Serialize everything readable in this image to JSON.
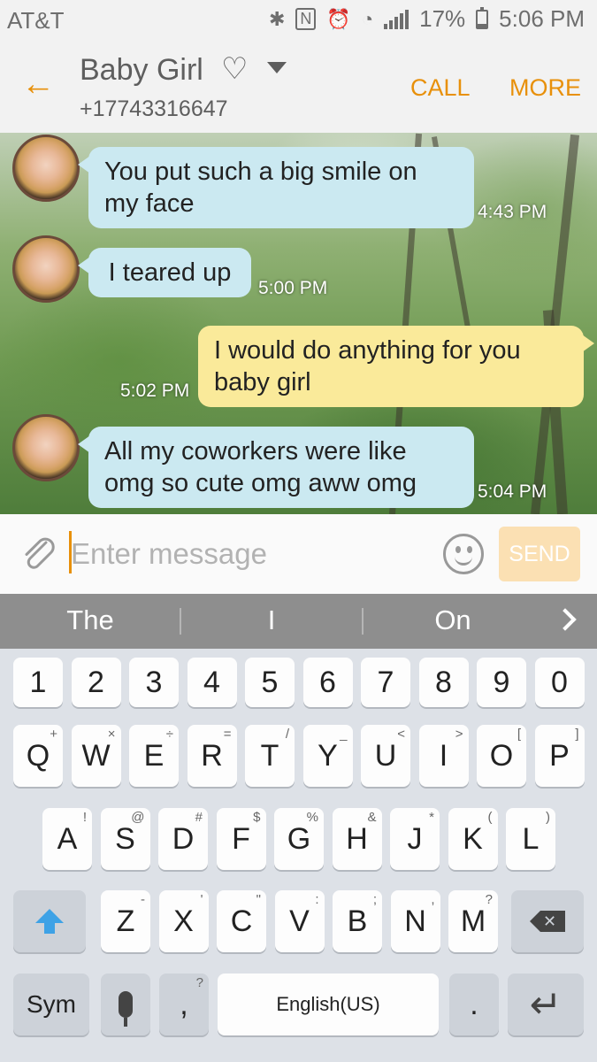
{
  "status_bar": {
    "carrier": "AT&T",
    "battery": "17%",
    "time": "5:06 PM",
    "icons": [
      "bluetooth-icon",
      "nfc-icon",
      "alarm-icon",
      "wifi-icon",
      "signal-icon",
      "battery-icon"
    ]
  },
  "header": {
    "back_icon": "arrow-left-icon",
    "contact_name": "Baby Girl",
    "heart": "♡",
    "contact_number": "+17743316647",
    "call_label": "CALL",
    "more_label": "MORE",
    "accent_color": "#e8900a"
  },
  "messages": [
    {
      "direction": "incoming",
      "text_lines": [
        "You put such a big smile on",
        "my face"
      ],
      "time": "4:43 PM"
    },
    {
      "direction": "incoming",
      "text_lines": [
        "I teared up"
      ],
      "time": "5:00 PM"
    },
    {
      "direction": "outgoing",
      "text_lines": [
        "I would do anything for you",
        "baby girl"
      ],
      "time": "5:02 PM"
    },
    {
      "direction": "incoming",
      "text_lines": [
        "All my coworkers were like",
        "omg so cute omg aww omg"
      ],
      "time": "5:04 PM"
    }
  ],
  "composer": {
    "placeholder": "Enter message",
    "send_label": "SEND"
  },
  "suggestions": [
    "The",
    "I",
    "On"
  ],
  "keyboard": {
    "number_row": [
      "1",
      "2",
      "3",
      "4",
      "5",
      "6",
      "7",
      "8",
      "9",
      "0"
    ],
    "row1": [
      "Q",
      "W",
      "E",
      "R",
      "T",
      "Y",
      "U",
      "I",
      "O",
      "P"
    ],
    "row1_hints": [
      "+",
      "×",
      "÷",
      "=",
      "/",
      "_",
      "<",
      ">",
      "[",
      "]"
    ],
    "row2": [
      "A",
      "S",
      "D",
      "F",
      "G",
      "H",
      "J",
      "K",
      "L"
    ],
    "row2_hints": [
      "!",
      "@",
      "#",
      "$",
      "%",
      "&",
      "*",
      "(",
      ")"
    ],
    "row3": [
      "Z",
      "X",
      "C",
      "V",
      "B",
      "N",
      "M"
    ],
    "row3_hints": [
      "-",
      "'",
      "\"",
      ":",
      ";",
      ",",
      "?"
    ],
    "sym_label": "Sym",
    "comma": ",",
    "comma_hint": "?",
    "space_label": "English(US)",
    "period": "."
  }
}
